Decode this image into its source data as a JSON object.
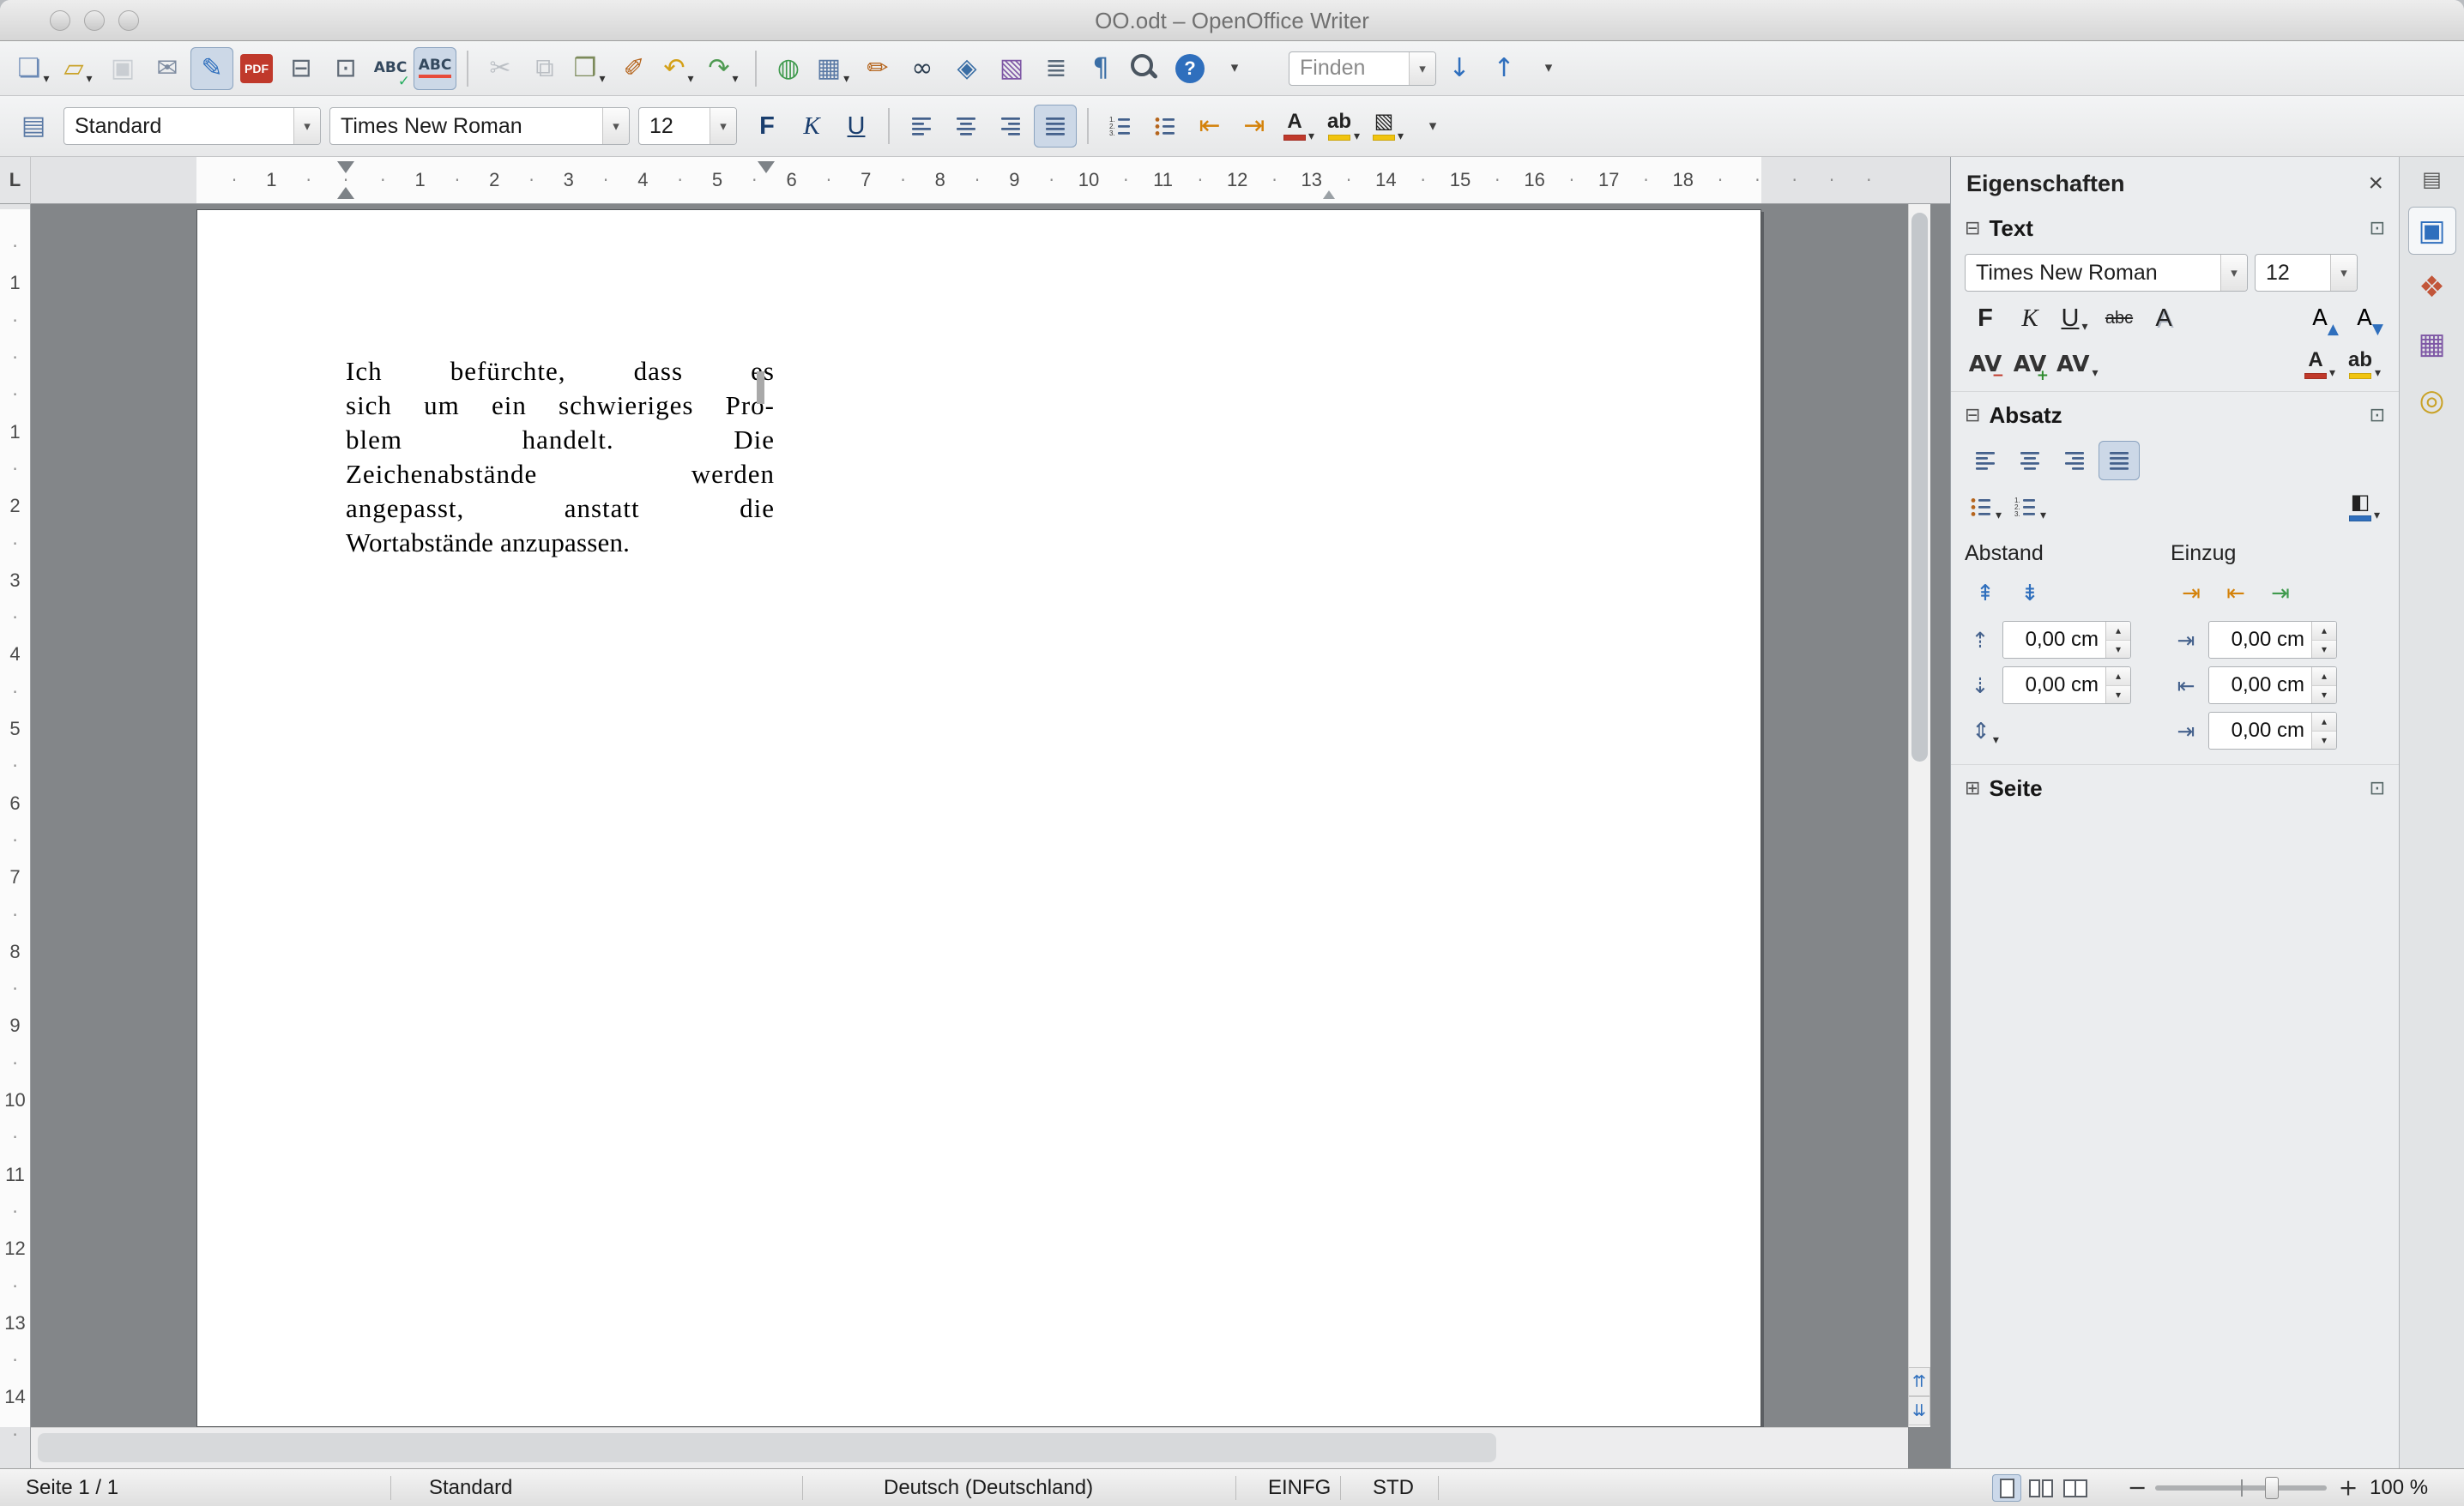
{
  "window": {
    "title": "OO.odt – OpenOffice Writer"
  },
  "misc": {
    "dropdown_arrow": "▾",
    "spin_up": "▴",
    "spin_down": "▾",
    "tab_selector": "L",
    "scroll_prev": "⇈",
    "scroll_next": "⇊",
    "slider_minus": "−",
    "slider_plus": "+"
  },
  "toolbar_main": {
    "items": [
      {
        "name": "new-document-icon",
        "glyph": "❏",
        "color": "#6a89b5",
        "dropdown": true
      },
      {
        "name": "open-icon",
        "glyph": "▱",
        "color": "#c9a227",
        "dropdown": true
      },
      {
        "name": "save-icon",
        "glyph": "▣",
        "color": "#8a94a0",
        "disabled": true
      },
      {
        "name": "mail-document-icon",
        "glyph": "✉",
        "color": "#7d8ba0"
      },
      {
        "name": "edit-file-icon",
        "glyph": "✎",
        "color": "#2f6fbd",
        "active": true
      },
      {
        "name": "export-pdf-icon",
        "kind": "pdf",
        "label": "PDF",
        "color": "#c0392b"
      },
      {
        "name": "print-icon",
        "glyph": "⊟",
        "color": "#5f6a76"
      },
      {
        "name": "page-preview-icon",
        "glyph": "⊡",
        "color": "#5f6a76"
      },
      {
        "name": "spellcheck-icon",
        "glyph": "ABC",
        "text_small": true,
        "color": "#34495e",
        "badge": "✓",
        "badge_color": "#27ae60"
      },
      {
        "name": "autospellcheck-icon",
        "glyph": "ABC",
        "text_small": true,
        "color": "#34495e",
        "underline_color": "#e74c3c",
        "active": true
      },
      {
        "kind": "sep"
      },
      {
        "name": "cut-icon",
        "glyph": "✂",
        "color": "#5f6a76",
        "disabled": true
      },
      {
        "name": "copy-icon",
        "glyph": "⧉",
        "color": "#5f6a76",
        "disabled": true
      },
      {
        "name": "paste-icon",
        "glyph": "❒",
        "color": "#7c8a5a",
        "dropdown": true
      },
      {
        "name": "format-paintbrush-icon",
        "glyph": "✐",
        "color": "#b5651d"
      },
      {
        "name": "undo-icon",
        "glyph": "↶",
        "color": "#d4a017",
        "dropdown": true
      },
      {
        "name": "redo-icon",
        "glyph": "↷",
        "color": "#4e9a51",
        "dropdown": true
      },
      {
        "kind": "sep"
      },
      {
        "name": "hyperlink-icon",
        "glyph": "◍",
        "color": "#3f9a4d"
      },
      {
        "name": "table-icon",
        "glyph": "▦",
        "color": "#5b7aa5",
        "dropdown": true
      },
      {
        "name": "draw-functions-icon",
        "glyph": "✏",
        "color": "#b5651d"
      },
      {
        "name": "find-replace-icon",
        "glyph": "∞",
        "color": "#2c3e50"
      },
      {
        "name": "navigator-icon",
        "glyph": "◈",
        "color": "#3a6ea5"
      },
      {
        "name": "gallery-icon",
        "glyph": "▧",
        "color": "#7e57a5"
      },
      {
        "name": "data-sources-icon",
        "glyph": "≣",
        "color": "#5a6a7a"
      },
      {
        "name": "formatting-marks-icon",
        "glyph": "¶",
        "color": "#3a6ea5"
      },
      {
        "name": "zoom-icon",
        "kind": "mag"
      },
      {
        "name": "help-icon",
        "kind": "circle",
        "glyph": "?",
        "color": "#2f6fbd"
      },
      {
        "name": "toolbar-main-overflow-icon",
        "glyph": "▾",
        "color": "#444",
        "small": true
      }
    ],
    "find": {
      "value": "Finden"
    },
    "find_items": [
      {
        "name": "find-next-icon",
        "glyph": "↓",
        "color": "#2f6fbd"
      },
      {
        "name": "find-previous-icon",
        "glyph": "↑",
        "color": "#2f6fbd"
      },
      {
        "name": "find-toolbar-overflow-icon",
        "glyph": "▾",
        "color": "#444",
        "small": true
      }
    ]
  },
  "toolbar_format": {
    "style_icon_glyph": "▤",
    "style_value": "Standard",
    "font_value": "Times New Roman",
    "size_value": "12",
    "items": [
      {
        "name": "bold-button",
        "kind": "text",
        "glyph": "F",
        "text_style": "bold",
        "color": "#1a3e6e"
      },
      {
        "name": "italic-button",
        "kind": "text",
        "glyph": "K",
        "text_style": "italic",
        "color": "#1a3e6e"
      },
      {
        "name": "underline-button",
        "kind": "text",
        "glyph": "U",
        "text_style": "underline",
        "color": "#1a3e6e"
      },
      {
        "kind": "sep"
      },
      {
        "name": "align-left-button",
        "kind": "align-left"
      },
      {
        "name": "align-center-button",
        "kind": "align-center"
      },
      {
        "name": "align-right-button",
        "kind": "align-right"
      },
      {
        "name": "align-justify-button",
        "kind": "align-justify",
        "active": true
      },
      {
        "kind": "sep"
      },
      {
        "name": "numbered-list-button",
        "kind": "list-number"
      },
      {
        "name": "bullet-list-button",
        "kind": "list-bullet"
      },
      {
        "name": "decrease-indent-button",
        "glyph": "⇤",
        "color": "#d4820a"
      },
      {
        "name": "increase-indent-button",
        "glyph": "⇥",
        "color": "#d4820a"
      },
      {
        "name": "font-color-button",
        "kind": "colorchip",
        "glyph": "A",
        "chip": "#c0392b",
        "dropdown": true
      },
      {
        "name": "highlight-button",
        "kind": "colorchip",
        "glyph": "ab",
        "chip": "#f1c40f",
        "dropdown": true
      },
      {
        "name": "background-color-button",
        "kind": "colorchip",
        "glyph": "▧",
        "chip": "#f1c40f",
        "dropdown": true
      },
      {
        "name": "toolbar-format-overflow-icon",
        "glyph": "▾",
        "color": "#444",
        "small": true
      }
    ]
  },
  "ruler": {
    "h_margin": "1",
    "h_numbers": [
      "1",
      "2",
      "3",
      "4",
      "5",
      "6",
      "7",
      "8",
      "9",
      "10",
      "11",
      "12",
      "13",
      "14",
      "15",
      "16",
      "17",
      "18"
    ],
    "v_margin": "1",
    "v_numbers": [
      "1",
      "2",
      "3",
      "4",
      "5",
      "6",
      "7",
      "8",
      "9",
      "10",
      "11",
      "12",
      "13",
      "14"
    ]
  },
  "document": {
    "lines": [
      "Ich befürchte, dass es",
      "sich um ein schwieriges Pro-",
      "blem handelt. Die",
      "Zeichenabstände werden",
      "angepasst, anstatt die",
      "Wortabstände anzupassen."
    ]
  },
  "sidebar": {
    "title": "Eigenschaften",
    "icons": {
      "collapse": "⊟",
      "expand": "⊞",
      "launcher": "⊡",
      "close": "×"
    },
    "sections": {
      "text": "Text",
      "paragraph": "Absatz",
      "page": "Seite"
    },
    "text": {
      "font": "Times New Roman",
      "size": "12",
      "row1": [
        {
          "name": "sidebar-bold-button",
          "kind": "text",
          "glyph": "F",
          "text_style": "bold",
          "color": "#222"
        },
        {
          "name": "sidebar-italic-button",
          "kind": "text",
          "glyph": "K",
          "text_style": "italic",
          "color": "#222"
        },
        {
          "name": "sidebar-underline-button",
          "kind": "text",
          "glyph": "U",
          "text_style": "underline",
          "color": "#222",
          "dropdown": true
        },
        {
          "name": "sidebar-strikethrough-button",
          "kind": "text",
          "glyph": "abc",
          "text_style": "strike",
          "color": "#222"
        },
        {
          "name": "sidebar-shadow-button",
          "kind": "text",
          "glyph": "A",
          "text_style": "shadowed",
          "color": "#222"
        }
      ],
      "row1_right": [
        {
          "name": "sidebar-increase-font-button",
          "glyph": "A",
          "badge": "▲",
          "badge_color": "#2f6fbd"
        },
        {
          "name": "sidebar-decrease-font-button",
          "glyph": "A",
          "badge": "▼",
          "badge_color": "#2f6fbd"
        }
      ],
      "row2": [
        {
          "name": "sidebar-decrease-char-spacing-button",
          "glyph": "AV",
          "text_small": true,
          "color": "#333",
          "badge": "−",
          "badge_color": "#c0392b"
        },
        {
          "name": "sidebar-increase-char-spacing-button",
          "glyph": "AV",
          "text_small": true,
          "color": "#333",
          "badge": "+",
          "badge_color": "#2e8b2e"
        },
        {
          "name": "sidebar-char-spacing-button",
          "glyph": "AV",
          "text_small": true,
          "color": "#333",
          "dropdown": true
        }
      ],
      "row2_right": [
        {
          "name": "sidebar-font-color-button",
          "kind": "colorchip",
          "glyph": "A",
          "chip": "#c0392b",
          "dropdown": true
        },
        {
          "name": "sidebar-highlight-button",
          "kind": "colorchip",
          "glyph": "ab",
          "chip": "#f1c40f",
          "dropdown": true
        }
      ]
    },
    "paragraph": {
      "align": [
        {
          "name": "sidebar-align-left-button",
          "kind": "align-left"
        },
        {
          "name": "sidebar-align-center-button",
          "kind": "align-center"
        },
        {
          "name": "sidebar-align-right-button",
          "kind": "align-right"
        },
        {
          "name": "sidebar-align-justify-button",
          "kind": "align-justify",
          "active": true
        }
      ],
      "lists": [
        {
          "name": "sidebar-bullet-list-button",
          "kind": "list-bullet",
          "dropdown": true
        },
        {
          "name": "sidebar-numbered-list-button",
          "kind": "list-number",
          "dropdown": true
        }
      ],
      "lists_right": [
        {
          "name": "sidebar-paragraph-background-button",
          "kind": "colorchip",
          "glyph": "◧",
          "chip": "#2f6fbd",
          "dropdown": true
        }
      ],
      "abstand_label": "Abstand",
      "einzug_label": "Einzug",
      "spacing_buttons": [
        {
          "name": "sidebar-increase-paragraph-spacing-button",
          "glyph": "⇞",
          "color": "#2f6fbd"
        },
        {
          "name": "sidebar-decrease-paragraph-spacing-button",
          "glyph": "⇟",
          "color": "#2f6fbd"
        }
      ],
      "indent_buttons": [
        {
          "name": "sidebar-increase-indent-button",
          "glyph": "⇥",
          "color": "#d4820a"
        },
        {
          "name": "sidebar-decrease-indent-button",
          "glyph": "⇤",
          "color": "#d4820a"
        },
        {
          "name": "sidebar-switch-indent-button",
          "glyph": "⇥",
          "color": "#3f9a4d"
        }
      ],
      "line_spacing_button": {
        "name": "sidebar-line-spacing-button",
        "glyph": "⇕",
        "color": "#44618c",
        "dropdown": true
      },
      "icons": {
        "above": "⇡",
        "below": "⇣",
        "before": "⇥",
        "after": "⇤",
        "first_line": "⇥"
      },
      "fields": {
        "above_spacing": "0,00 cm",
        "below_spacing": "0,00 cm",
        "before_indent": "0,00 cm",
        "after_indent": "0,00 cm",
        "first_line_indent": "0,00 cm"
      }
    }
  },
  "tabstrip": {
    "settings_icon": "▤",
    "tabs": [
      {
        "name": "properties-tab",
        "glyph": "▣",
        "color": "#2f6fbd",
        "active": true
      },
      {
        "name": "styles-tab",
        "glyph": "❖",
        "color": "#c2563a"
      },
      {
        "name": "gallery-tab",
        "glyph": "▦",
        "color": "#7e57a5"
      },
      {
        "name": "navigator-tab",
        "glyph": "◎",
        "color": "#c9a227"
      }
    ]
  },
  "statusbar": {
    "page": "Seite 1 / 1",
    "style": "Standard",
    "language": "Deutsch (Deutschland)",
    "insert_mode": "EINFG",
    "selection_mode": "STD",
    "zoom_label": "100 %"
  }
}
